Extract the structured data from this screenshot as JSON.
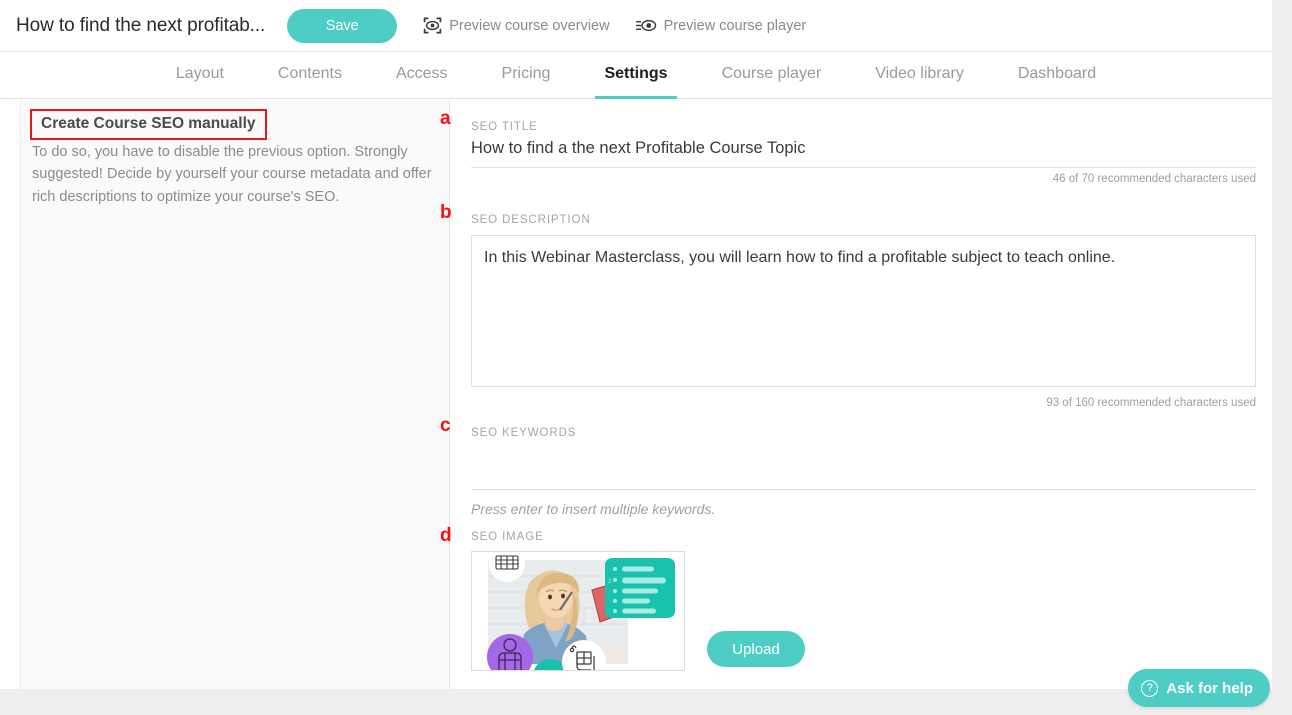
{
  "header": {
    "course_title": "How to find the next profitab...",
    "save_label": "Save",
    "preview_overview_label": "Preview course overview",
    "preview_player_label": "Preview course player",
    "preview_overview_icon": "eye-in-frame-icon",
    "preview_player_icon": "eye-lines-icon"
  },
  "tabs": [
    {
      "label": "Layout",
      "active": false
    },
    {
      "label": "Contents",
      "active": false
    },
    {
      "label": "Access",
      "active": false
    },
    {
      "label": "Pricing",
      "active": false
    },
    {
      "label": "Settings",
      "active": true
    },
    {
      "label": "Course player",
      "active": false
    },
    {
      "label": "Video library",
      "active": false
    },
    {
      "label": "Dashboard",
      "active": false
    }
  ],
  "sidebar": {
    "heading": "Create Course SEO manually",
    "description": "To do so, you have to disable the previous option. Strongly suggested! Decide by yourself your course metadata and offer rich descriptions to optimize your course's SEO."
  },
  "form": {
    "seo_title": {
      "annotation": "a",
      "label": "SEO TITLE",
      "value": "How to find a the next Profitable Course Topic",
      "placeholder": "",
      "counter": "46 of 70 recommended characters used"
    },
    "seo_description": {
      "annotation": "b",
      "label": "SEO DESCRIPTION",
      "value": "In this Webinar Masterclass, you will learn how to find a profitable subject to teach online.",
      "placeholder": "",
      "counter": "93 of 160 recommended characters used"
    },
    "seo_keywords": {
      "annotation": "c",
      "label": "SEO KEYWORDS",
      "value": "",
      "placeholder": "",
      "hint": "Press enter to insert multiple keywords."
    },
    "seo_image": {
      "annotation": "d",
      "label": "SEO IMAGE",
      "upload_label": "Upload",
      "thumbnail_alt": "course-cover-thumbnail"
    }
  },
  "help": {
    "label": "Ask for help",
    "icon": "question-mark-icon"
  },
  "colors": {
    "accent_teal": "#4ecdc4",
    "annotation_red": "#fc0d0d",
    "text_dark": "#2b2b2b",
    "text_muted": "#9a9a9a",
    "page_bg": "#eeeeee",
    "sidebar_bg": "#fafafa"
  }
}
